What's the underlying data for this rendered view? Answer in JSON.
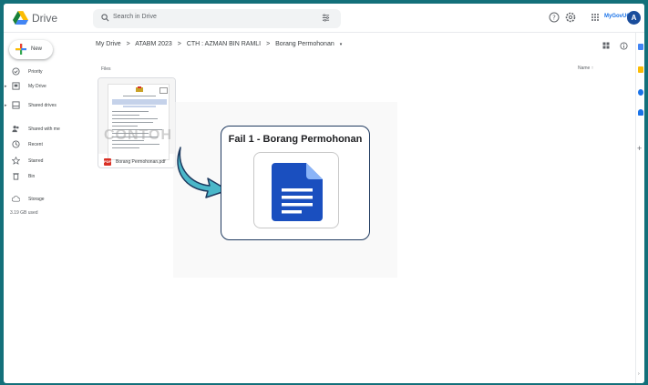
{
  "app": {
    "name": "Drive"
  },
  "search": {
    "placeholder": "Search in Drive"
  },
  "account": {
    "org_label": "MyGovUC™",
    "avatar_initial": "A"
  },
  "sidebar": {
    "new_label": "New",
    "items": [
      {
        "label": "Priority",
        "icon": "priority-icon",
        "has_caret": false
      },
      {
        "label": "My Drive",
        "icon": "my-drive-icon",
        "has_caret": true
      },
      {
        "label": "Shared drives",
        "icon": "shared-drives-icon",
        "has_caret": true
      },
      {
        "label": "Shared with me",
        "icon": "shared-with-me-icon",
        "has_caret": false
      },
      {
        "label": "Recent",
        "icon": "recent-icon",
        "has_caret": false
      },
      {
        "label": "Starred",
        "icon": "starred-icon",
        "has_caret": false
      },
      {
        "label": "Bin",
        "icon": "bin-icon",
        "has_caret": false
      },
      {
        "label": "Storage",
        "icon": "storage-icon",
        "has_caret": false
      }
    ],
    "storage_used": "3.19 GB used"
  },
  "main": {
    "breadcrumb": [
      "My Drive",
      "ATABM 2023",
      "CTH : AZMAN BIN RAMLI",
      "Borang Permohonan"
    ],
    "breadcrumb_sep": ">",
    "section_label": "Files",
    "sort_label": "Name ↑",
    "files": [
      {
        "name": "Borang Permohonan.pdf",
        "type_badge": "PDF",
        "watermark": "CONTOH"
      }
    ]
  },
  "callout": {
    "title": "Fail 1 - Borang Permohonan"
  },
  "colors": {
    "frame": "#13707a",
    "arrow": "#4ab7c9",
    "doc_icon": "#1a4fbf",
    "pdf_red": "#d93025",
    "link_blue": "#1a73e8"
  }
}
